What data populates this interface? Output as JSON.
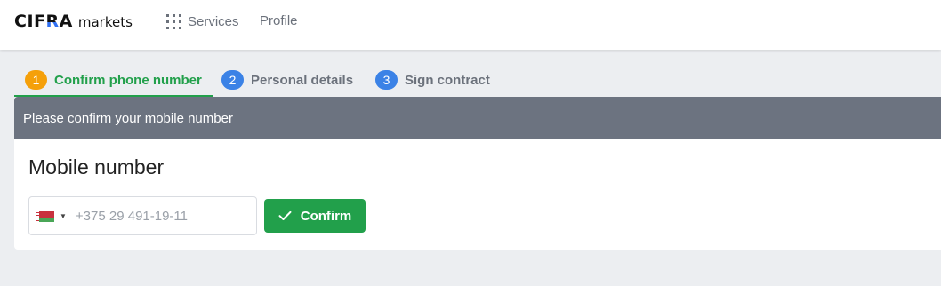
{
  "header": {
    "logo_mark_prefix": "CIF",
    "logo_mark_accent": "R",
    "logo_mark_suffix": "A",
    "logo_sub": "markets",
    "nav": [
      {
        "label": "Services",
        "icon": "grid-icon"
      },
      {
        "label": "Profile"
      }
    ]
  },
  "steps": [
    {
      "number": "1",
      "label": "Confirm phone number",
      "state": "active",
      "color": "#f5a00a"
    },
    {
      "number": "2",
      "label": "Personal details",
      "state": "inactive",
      "color": "#3b82e6"
    },
    {
      "number": "3",
      "label": "Sign contract",
      "state": "inactive",
      "color": "#3b82e6"
    }
  ],
  "card": {
    "header_text": "Please confirm your mobile number",
    "title": "Mobile number",
    "phone": {
      "country": "Belarus",
      "flag_icon": "belarus-flag-icon",
      "placeholder": "+375 29 491-19-11",
      "value": ""
    },
    "confirm_label": "Confirm"
  },
  "colors": {
    "accent_green": "#22a04b",
    "step_active": "#f5a00a",
    "step_inactive": "#3b82e6",
    "card_header": "#6c7380",
    "background": "#eceef1"
  }
}
